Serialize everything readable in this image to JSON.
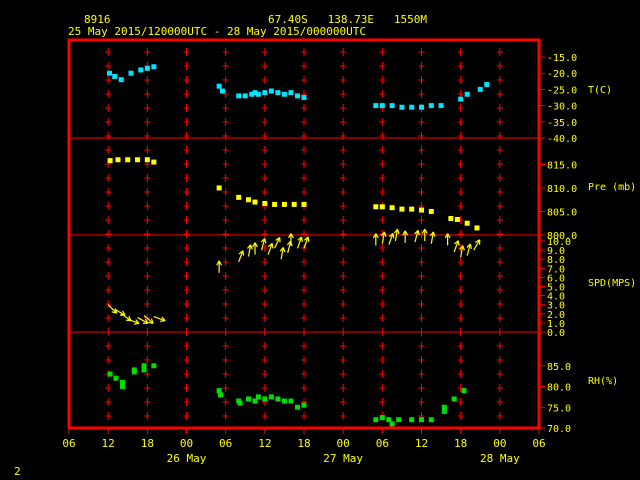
{
  "header": {
    "station_id": "8916",
    "location": "67.40S   138.73E   1550M",
    "time_range": "25 May 2015/120000UTC - 28 May 2015/000000UTC"
  },
  "footer": {
    "page_number": "2"
  },
  "colors": {
    "frame": "#ff0000",
    "grid": "#ff0000",
    "text": "#ffff00",
    "temperature": "#00e5ff",
    "pressure": "#ffff00",
    "wind": "#ffff00",
    "humidity": "#00e000",
    "background": "#000000"
  },
  "chart_data": {
    "type": "scatter",
    "x_axis": {
      "unit": "hours since 25 May 06 UTC",
      "range": [
        0,
        72
      ],
      "tick_labels": [
        "06",
        "12",
        "18",
        "00",
        "06",
        "12",
        "18",
        "00",
        "06",
        "12",
        "18",
        "00",
        "06"
      ],
      "date_labels": [
        {
          "label": "26 May",
          "at_hour": 18
        },
        {
          "label": "27 May",
          "at_hour": 42
        },
        {
          "label": "28 May",
          "at_hour": 66
        }
      ]
    },
    "panels": [
      {
        "id": "temperature",
        "label": "T(C)",
        "range": [
          -40,
          -15
        ],
        "ticks": [
          {
            "v": -15,
            "t": "-15.0"
          },
          {
            "v": -20,
            "t": "-20.0"
          },
          {
            "v": -25,
            "t": "-25.0"
          },
          {
            "v": -30,
            "t": "-30.0"
          },
          {
            "v": -35,
            "t": "-35.0"
          },
          {
            "v": -40,
            "t": "-40.0"
          }
        ],
        "points": [
          [
            6.2,
            -20
          ],
          [
            7,
            -21
          ],
          [
            8,
            -22
          ],
          [
            9.5,
            -20
          ],
          [
            11,
            -19
          ],
          [
            12,
            -18.5
          ],
          [
            13,
            -18
          ],
          [
            23,
            -24
          ],
          [
            23.5,
            -25.5
          ],
          [
            26,
            -27
          ],
          [
            27,
            -27
          ],
          [
            28,
            -26.5
          ],
          [
            28.5,
            -26
          ],
          [
            29,
            -26.5
          ],
          [
            30,
            -26
          ],
          [
            31,
            -25.5
          ],
          [
            32,
            -26
          ],
          [
            33,
            -26.5
          ],
          [
            34,
            -26
          ],
          [
            35,
            -27
          ],
          [
            36,
            -27.5
          ],
          [
            47,
            -30
          ],
          [
            48,
            -30
          ],
          [
            49.5,
            -30
          ],
          [
            51,
            -30.5
          ],
          [
            52.5,
            -30.5
          ],
          [
            54,
            -30.5
          ],
          [
            55.5,
            -30
          ],
          [
            57,
            -30
          ],
          [
            60,
            -28
          ],
          [
            61,
            -26.5
          ],
          [
            63,
            -25
          ],
          [
            64,
            -23.5
          ]
        ]
      },
      {
        "id": "pressure",
        "label": "Pre (mb)",
        "range": [
          800,
          820
        ],
        "ticks": [
          {
            "v": 800,
            "t": "800.0"
          },
          {
            "v": 805,
            "t": "805.0"
          },
          {
            "v": 810,
            "t": "810.0"
          },
          {
            "v": 815,
            "t": "815.0"
          }
        ],
        "points": [
          [
            6.3,
            815.8
          ],
          [
            7.5,
            816
          ],
          [
            9,
            816
          ],
          [
            10.5,
            816
          ],
          [
            12,
            816
          ],
          [
            13,
            815.5
          ],
          [
            23,
            810
          ],
          [
            26,
            808
          ],
          [
            27.5,
            807.5
          ],
          [
            28.5,
            807
          ],
          [
            30,
            806.7
          ],
          [
            31.5,
            806.5
          ],
          [
            33,
            806.5
          ],
          [
            34.5,
            806.5
          ],
          [
            36,
            806.5
          ],
          [
            47,
            806
          ],
          [
            48,
            806
          ],
          [
            49.5,
            805.8
          ],
          [
            51,
            805.5
          ],
          [
            52.5,
            805.5
          ],
          [
            54,
            805.3
          ],
          [
            55.5,
            805
          ],
          [
            58.5,
            803.5
          ],
          [
            59.5,
            803.3
          ],
          [
            61,
            802.5
          ],
          [
            62.5,
            801.5
          ]
        ]
      },
      {
        "id": "wind",
        "label": "SPD(MPS)",
        "range": [
          0,
          10
        ],
        "ticks": [
          {
            "v": 0,
            "t": "0.0"
          },
          {
            "v": 1,
            "t": "1.0"
          },
          {
            "v": 2,
            "t": "2.0"
          },
          {
            "v": 3,
            "t": "3.0"
          },
          {
            "v": 4,
            "t": "4.0"
          },
          {
            "v": 5,
            "t": "5.0"
          },
          {
            "v": 6,
            "t": "6.0"
          },
          {
            "v": 7,
            "t": "7.0"
          },
          {
            "v": 8,
            "t": "8.0"
          },
          {
            "v": 9,
            "t": "9.0"
          },
          {
            "v": 10,
            "t": "10.0"
          }
        ],
        "points": [
          [
            6,
            3,
            135
          ],
          [
            7,
            2.5,
            120
          ],
          [
            8,
            2,
            125
          ],
          [
            9,
            1.4,
            110
          ],
          [
            10.5,
            1.6,
            120
          ],
          [
            11.5,
            1.8,
            130
          ],
          [
            13,
            1.7,
            110
          ],
          [
            23,
            6.5,
            0
          ],
          [
            26,
            7.7,
            20
          ],
          [
            27.5,
            8.3,
            10
          ],
          [
            28.5,
            8.5,
            0
          ],
          [
            29.5,
            9,
            15
          ],
          [
            30.5,
            8.5,
            20
          ],
          [
            31.5,
            9.2,
            25
          ],
          [
            32.5,
            8,
            10
          ],
          [
            33.5,
            8.7,
            15
          ],
          [
            34,
            9.5,
            0
          ],
          [
            35,
            9.2,
            20
          ],
          [
            36,
            9.2,
            20
          ],
          [
            47,
            9.5,
            0
          ],
          [
            48,
            9.7,
            10
          ],
          [
            49,
            9.6,
            20
          ],
          [
            50,
            10,
            10
          ],
          [
            51.5,
            9.8,
            0
          ],
          [
            53,
            9.9,
            15
          ],
          [
            54.5,
            10,
            0
          ],
          [
            55.5,
            9.7,
            10
          ],
          [
            58,
            9.5,
            0
          ],
          [
            59,
            8.8,
            20
          ],
          [
            60,
            8.2,
            10
          ],
          [
            61,
            8.4,
            15
          ],
          [
            62,
            9,
            30
          ]
        ]
      },
      {
        "id": "humidity",
        "label": "RH(%)",
        "range": [
          70,
          90
        ],
        "ticks": [
          {
            "v": 70,
            "t": "70.0"
          },
          {
            "v": 75,
            "t": "75.0"
          },
          {
            "v": 80,
            "t": "80.0"
          },
          {
            "v": 85,
            "t": "85.0"
          }
        ],
        "points": [
          [
            6.3,
            83
          ],
          [
            7.2,
            82
          ],
          [
            8.2,
            81
          ],
          [
            8.2,
            80
          ],
          [
            10,
            83.5
          ],
          [
            10,
            84
          ],
          [
            11.5,
            85
          ],
          [
            11.5,
            84
          ],
          [
            13,
            85
          ],
          [
            23,
            79
          ],
          [
            23.2,
            78
          ],
          [
            26,
            76.5
          ],
          [
            26.2,
            76
          ],
          [
            27.5,
            77
          ],
          [
            28.5,
            76.5
          ],
          [
            29,
            77.5
          ],
          [
            30,
            77
          ],
          [
            31,
            77.5
          ],
          [
            32,
            77
          ],
          [
            33,
            76.5
          ],
          [
            34,
            76.5
          ],
          [
            35,
            75
          ],
          [
            36,
            75.5
          ],
          [
            47,
            72
          ],
          [
            48,
            72.5
          ],
          [
            49,
            72
          ],
          [
            49.5,
            71
          ],
          [
            50.5,
            72
          ],
          [
            52.5,
            72
          ],
          [
            54,
            72
          ],
          [
            55.5,
            72
          ],
          [
            57.5,
            75
          ],
          [
            57.5,
            74
          ],
          [
            59,
            77
          ],
          [
            60.5,
            79
          ]
        ]
      }
    ]
  }
}
